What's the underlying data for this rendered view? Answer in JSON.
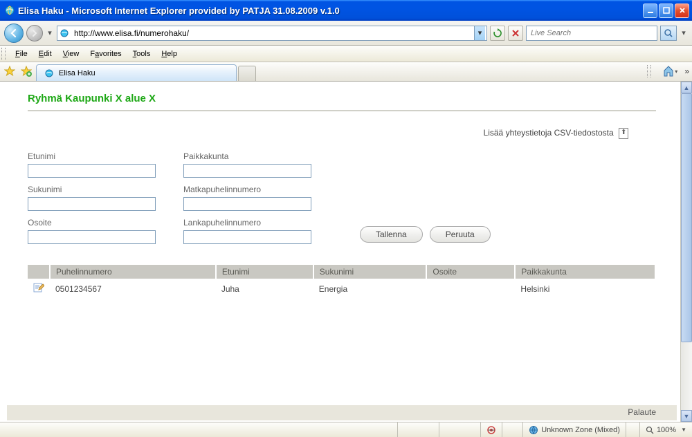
{
  "window": {
    "title": "Elisa Haku - Microsoft Internet Explorer provided by PATJA 31.08.2009 v.1.0"
  },
  "nav": {
    "url": "http://www.elisa.fi/numerohaku/",
    "search_placeholder": "Live Search"
  },
  "menu": {
    "file": "File",
    "edit": "Edit",
    "view": "View",
    "favorites": "Favorites",
    "tools": "Tools",
    "help": "Help"
  },
  "tabs": {
    "active_title": "Elisa Haku"
  },
  "page": {
    "heading": "Ryhmä Kaupunki X alue X",
    "csv_link": "Lisää yhteystietoja CSV-tiedostosta",
    "form": {
      "etunimi_label": "Etunimi",
      "sukunimi_label": "Sukunimi",
      "osoite_label": "Osoite",
      "paikkakunta_label": "Paikkakunta",
      "matka_label": "Matkapuhelinnumero",
      "lanka_label": "Lankapuhelinnumero",
      "etunimi_value": "",
      "sukunimi_value": "",
      "osoite_value": "",
      "paikkakunta_value": "",
      "matka_value": "",
      "lanka_value": ""
    },
    "buttons": {
      "save": "Tallenna",
      "cancel": "Peruuta"
    },
    "table": {
      "headers": {
        "phone": "Puhelinnumero",
        "first": "Etunimi",
        "last": "Sukunimi",
        "address": "Osoite",
        "city": "Paikkakunta"
      },
      "rows": [
        {
          "phone": "0501234567",
          "first": "Juha",
          "last": "Energia",
          "address": "",
          "city": "Helsinki"
        }
      ]
    },
    "feedback": "Palaute"
  },
  "status": {
    "zone": "Unknown Zone (Mixed)",
    "zoom": "100%"
  }
}
